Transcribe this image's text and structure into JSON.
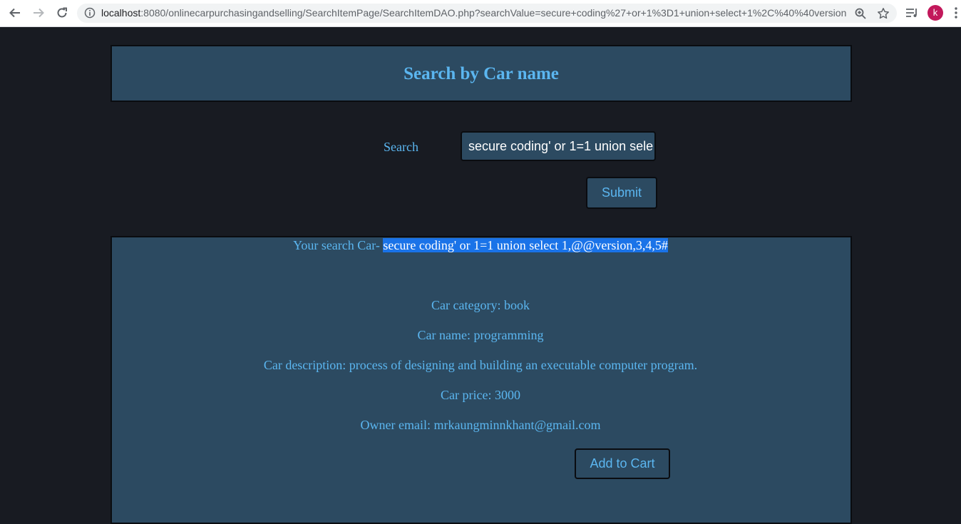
{
  "browser": {
    "url_host": "localhost",
    "url_rest": ":8080/onlinecarpurchasingandselling/SearchItemPage/SearchItemDAO.php?searchValue=secure+coding%27+or+1%3D1+union+select+1%2C%40%40version...",
    "profile_initial": "k"
  },
  "header": {
    "title": "Search by Car name"
  },
  "search": {
    "label": "Search",
    "value": "secure coding' or 1=1 union sele",
    "submit_label": "Submit"
  },
  "results": {
    "query_prefix": "Your search Car- ",
    "query_value": "secure coding' or 1=1 union select 1,@@version,3,4,5#",
    "category": "Car category: book",
    "name": "Car name: programming",
    "description": "Car description: process of designing and building an executable computer program.",
    "price": "Car price: 3000",
    "owner_email": "Owner email: mrkaungminnkhant@gmail.com",
    "add_to_cart_label": "Add to Cart"
  },
  "colors": {
    "page_bg": "#181b22",
    "panel_bg": "#2c4a61",
    "accent_text": "#5bb6f0",
    "selection": "#1a73e8"
  }
}
